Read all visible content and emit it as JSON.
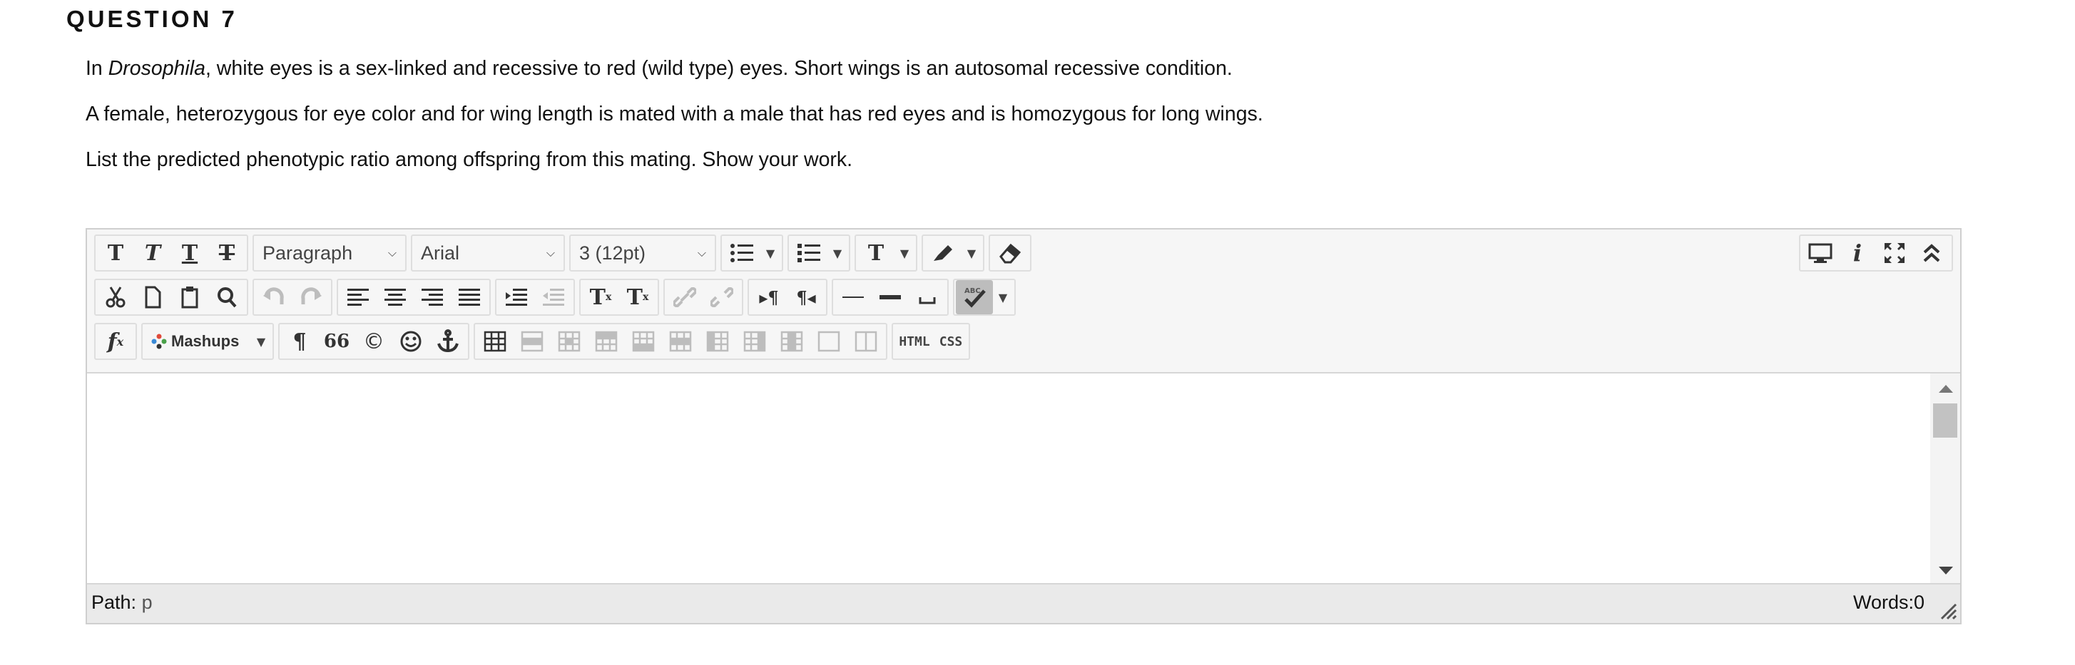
{
  "question": {
    "title": "QUESTION 7",
    "line1_prefix": "In ",
    "line1_italic": "Drosophila",
    "line1_rest": ", white eyes is a sex-linked and recessive to red (wild type) eyes. Short wings is an autosomal recessive condition.",
    "line2": "A female, heterozygous for eye color and for wing length is mated with a male that has red eyes and is homozygous for long wings.",
    "line3": "List the predicted phenotypic ratio among offspring from this mating. Show your work."
  },
  "toolbar": {
    "format_block": "Paragraph",
    "font_family": "Arial",
    "font_size": "3 (12pt)",
    "mashups_label": "Mashups",
    "html_label": "HTML",
    "css_label": "CSS",
    "spellcheck_label": "ABC",
    "icons": {
      "bold": "T",
      "italic": "T",
      "underline": "T",
      "strike": "T",
      "superscript": "T",
      "subscript": "T",
      "text_color": "T",
      "pilcrow": "¶",
      "quote": "66",
      "copyright": "©",
      "function": "f"
    }
  },
  "editor": {
    "content": ""
  },
  "status": {
    "path_label": "Path:",
    "path_value": "p",
    "words": "Words:0"
  },
  "colors": {
    "toolbar_bg": "#f6f6f6",
    "status_bg": "#eaeaea",
    "border": "#cfcfcf"
  }
}
